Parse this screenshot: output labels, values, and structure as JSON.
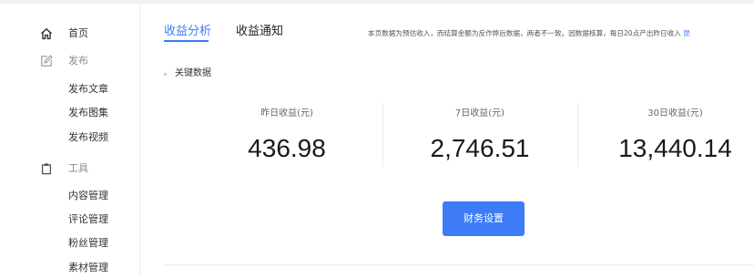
{
  "sidebar": {
    "items": [
      {
        "label": "首页",
        "icon": "home-icon"
      },
      {
        "label": "发布",
        "icon": "edit-icon"
      },
      {
        "label": "发布文章"
      },
      {
        "label": "发布图集"
      },
      {
        "label": "发布视频"
      },
      {
        "label": "工具",
        "icon": "clipboard-icon"
      },
      {
        "label": "内容管理"
      },
      {
        "label": "评论管理"
      },
      {
        "label": "粉丝管理"
      },
      {
        "label": "素材管理"
      }
    ]
  },
  "tabs": [
    {
      "label": "收益分析",
      "active": true
    },
    {
      "label": "收益通知",
      "active": false
    }
  ],
  "notice": {
    "text": "本页数据为预估收入，而结算金额为反作弊后数据，两者不一致。因数据核算，每日20点产出昨日收入",
    "link": "昆"
  },
  "section": {
    "title": "关键数据"
  },
  "stats": [
    {
      "label": "昨日收益(元)",
      "value": "436.98"
    },
    {
      "label": "7日收益(元)",
      "value": "2,746.51"
    },
    {
      "label": "30日收益(元)",
      "value": "13,440.14"
    }
  ],
  "actions": {
    "finance_settings": "财务设置"
  },
  "colors": {
    "accent": "#3d7bf7",
    "divider": "#ececec",
    "muted_text": "#8a8a8a"
  }
}
